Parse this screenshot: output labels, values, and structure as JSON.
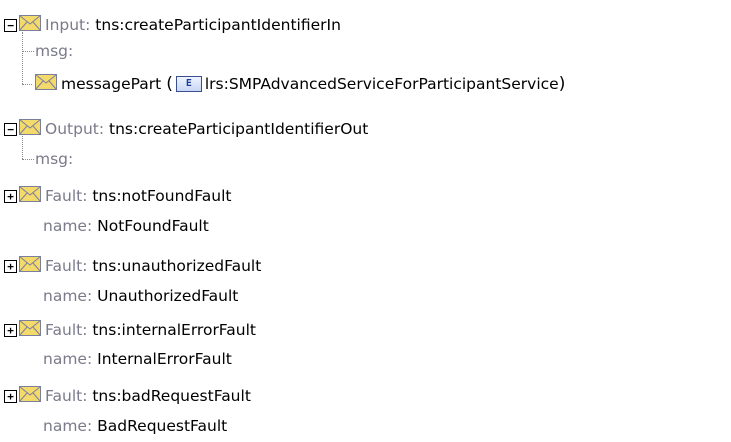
{
  "colors": {
    "label": "#7a7a8a",
    "envelope_fill": "#f4d96b",
    "envelope_border": "#7a7f9e",
    "badge_border": "#3b4f8f"
  },
  "input": {
    "toggle": "−",
    "label": "Input:",
    "value": "tns:createParticipantIdentifierIn",
    "msg_label": "msg:",
    "part": {
      "name": "messagePart",
      "open": "(",
      "badge": "E",
      "type": "lrs:SMPAdvancedServiceForParticipantService",
      "close": ")"
    }
  },
  "output": {
    "toggle": "−",
    "label": "Output:",
    "value": "tns:createParticipantIdentifierOut",
    "msg_label": "msg:"
  },
  "faults": [
    {
      "toggle": "+",
      "label": "Fault:",
      "value": "tns:notFoundFault",
      "name_label": "name:",
      "name_value": "NotFoundFault"
    },
    {
      "toggle": "+",
      "label": "Fault:",
      "value": "tns:unauthorizedFault",
      "name_label": "name:",
      "name_value": "UnauthorizedFault"
    },
    {
      "toggle": "+",
      "label": "Fault:",
      "value": "tns:internalErrorFault",
      "name_label": "name:",
      "name_value": "InternalErrorFault"
    },
    {
      "toggle": "+",
      "label": "Fault:",
      "value": "tns:badRequestFault",
      "name_label": "name:",
      "name_value": "BadRequestFault"
    }
  ]
}
